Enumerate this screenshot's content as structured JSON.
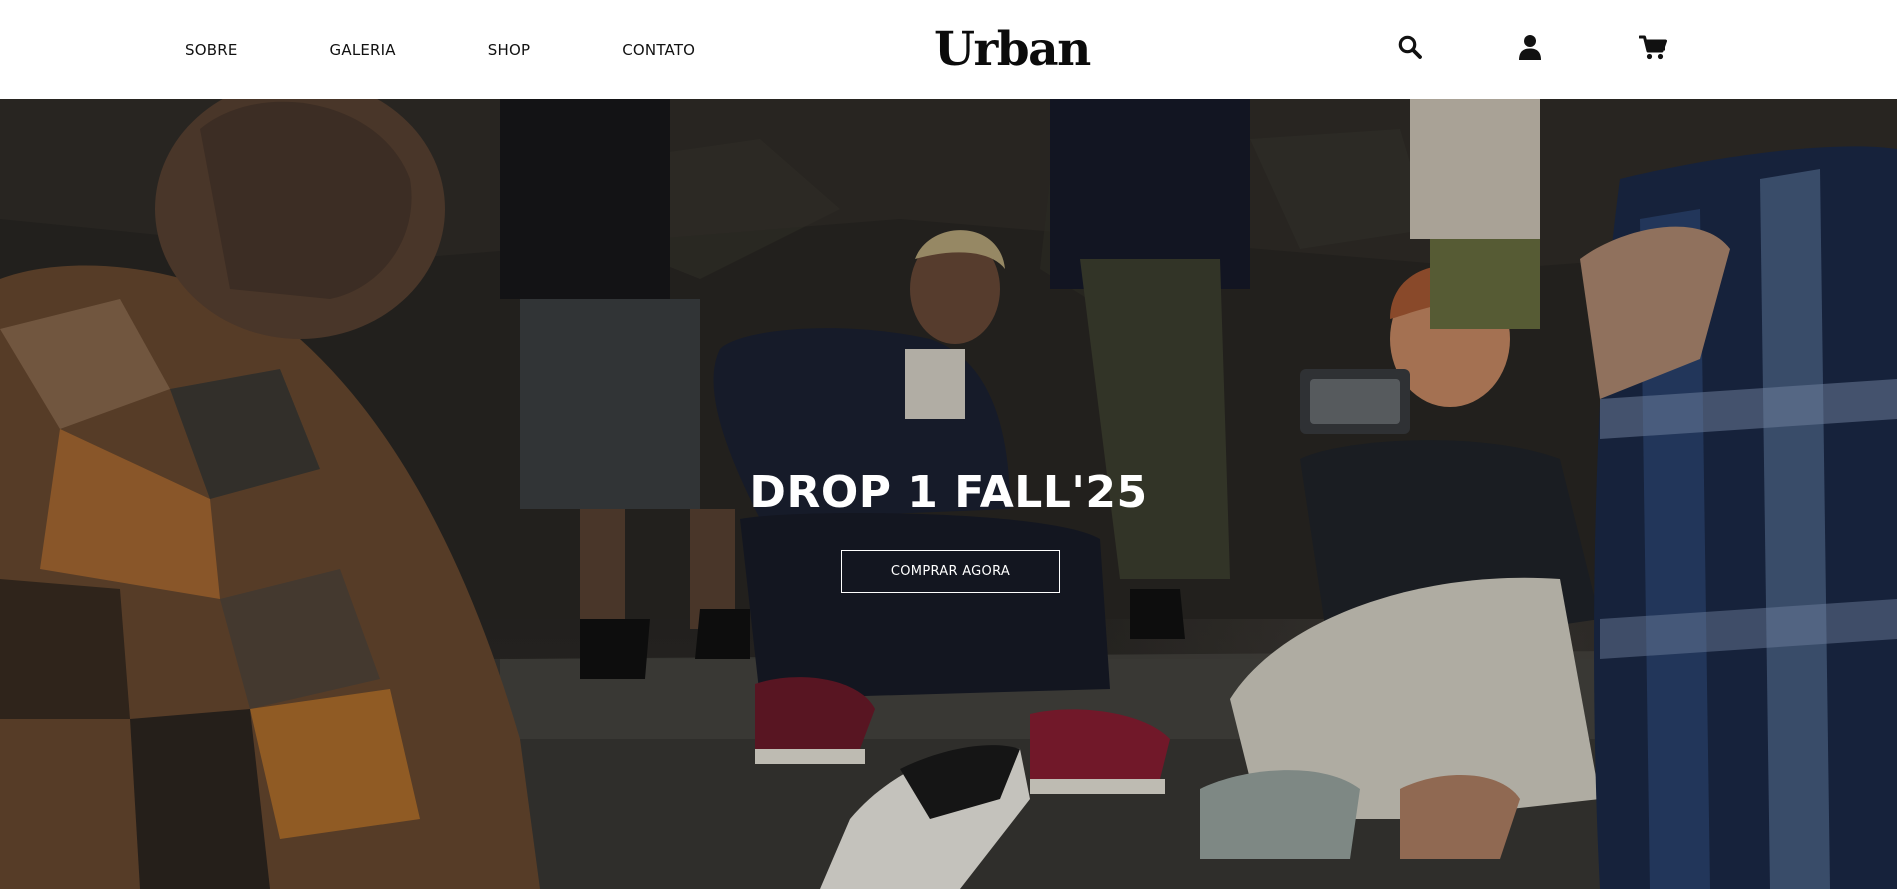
{
  "header": {
    "brand": "Urban",
    "nav": [
      {
        "label": "SOBRE"
      },
      {
        "label": "GALERIA"
      },
      {
        "label": "SHOP"
      },
      {
        "label": "CONTATO"
      }
    ],
    "icons": [
      "search-icon",
      "user-icon",
      "cart-icon"
    ]
  },
  "hero": {
    "title": "DROP 1 FALL'25",
    "cta_label": "COMPRAR AGORA"
  },
  "colors": {
    "header_bg": "#ffffff",
    "text_dark": "#111111",
    "hero_text": "#ffffff"
  }
}
